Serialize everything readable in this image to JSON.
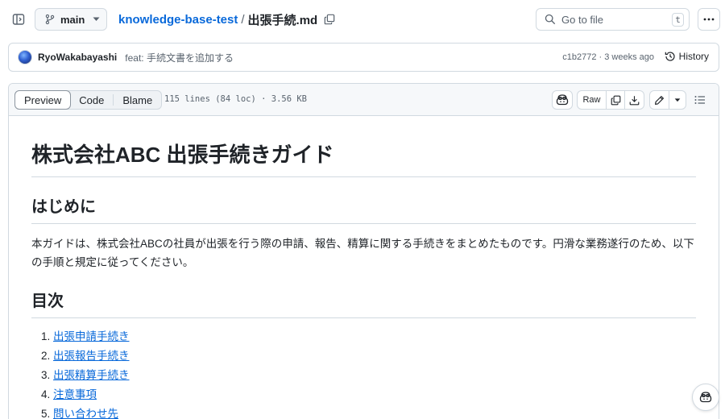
{
  "header": {
    "branch_label": "main",
    "repo_name": "knowledge-base-test",
    "separator": "/",
    "file_name": "出張手続.md",
    "goto_placeholder": "Go to file",
    "goto_shortcut": "t"
  },
  "commit": {
    "author": "RyoWakabayashi",
    "message": "feat: 手続文書を追加する",
    "hash": "c1b2772",
    "meta_sep": " · ",
    "time": "3 weeks ago",
    "history_label": "History"
  },
  "file_header": {
    "tabs": [
      "Preview",
      "Code",
      "Blame"
    ],
    "active_tab": "Preview",
    "stats": "115 lines (84 loc) · 3.56 KB",
    "raw_label": "Raw"
  },
  "document": {
    "title": "株式会社ABC 出張手続きガイド",
    "intro_heading": "はじめに",
    "intro_text": "本ガイドは、株式会社ABCの社員が出張を行う際の申請、報告、精算に関する手続きをまとめたものです。円滑な業務遂行のため、以下の手順と規定に従ってください。",
    "toc_heading": "目次",
    "toc_items": [
      "出張申請手続き",
      "出張報告手続き",
      "出張精算手続き",
      "注意事項",
      "問い合わせ先"
    ]
  },
  "icons": {
    "sidebar_toggle": "sidebar-toggle-icon",
    "branch": "git-branch-icon",
    "copy": "copy-icon",
    "search": "search-icon",
    "kebab": "kebab-horizontal-icon",
    "history": "history-icon",
    "copilot": "copilot-icon",
    "download": "download-icon",
    "pencil": "pencil-icon",
    "list": "list-unordered-icon"
  },
  "colors": {
    "link": "#0969da",
    "border": "#d1d9e0",
    "muted": "#59636e",
    "text": "#1f2328"
  }
}
